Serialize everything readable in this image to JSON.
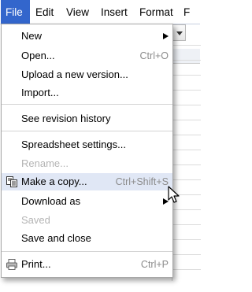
{
  "menubar": {
    "items": [
      "File",
      "Edit",
      "View",
      "Insert",
      "Format",
      "F"
    ],
    "active": "File"
  },
  "file_menu": {
    "new": {
      "label": "New",
      "has_submenu": true
    },
    "open": {
      "label": "Open...",
      "shortcut": "Ctrl+O"
    },
    "upload": {
      "label": "Upload a new version..."
    },
    "import": {
      "label": "Import..."
    },
    "revision_history": {
      "label": "See revision history"
    },
    "spreadsheet_settings": {
      "label": "Spreadsheet settings..."
    },
    "rename": {
      "label": "Rename...",
      "disabled": true
    },
    "make_copy": {
      "label": "Make a copy...",
      "shortcut": "Ctrl+Shift+S",
      "highlighted": true,
      "icon": "copy-icon"
    },
    "download_as": {
      "label": "Download as",
      "has_submenu": true
    },
    "saved": {
      "label": "Saved",
      "disabled": true
    },
    "save_close": {
      "label": "Save and close"
    },
    "print": {
      "label": "Print...",
      "shortcut": "Ctrl+P",
      "icon": "printer-icon"
    }
  },
  "colors": {
    "menubar_active_bg": "#3366cc",
    "highlight_bg": "#e0e7f5",
    "disabled_text": "#b4b4b4",
    "shortcut_text": "#8c8c8c"
  }
}
